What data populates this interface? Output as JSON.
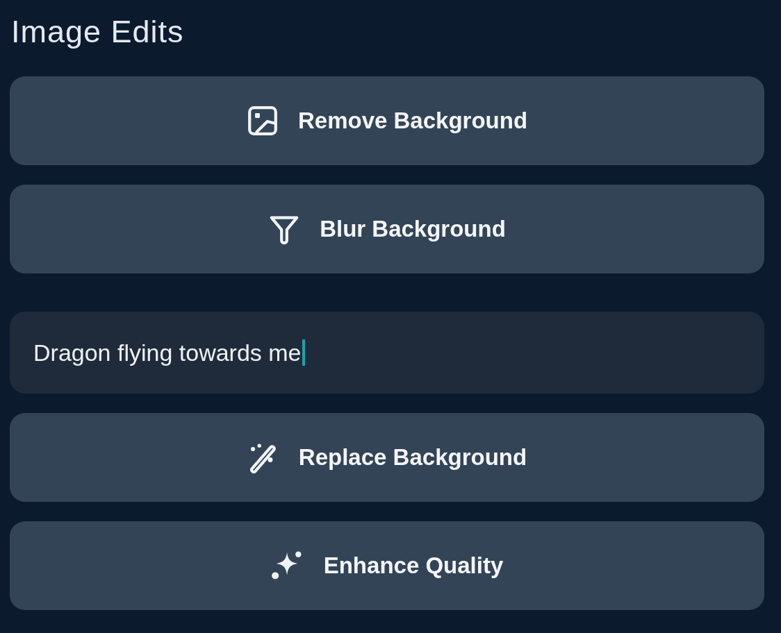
{
  "panel": {
    "title": "Image Edits"
  },
  "actions": [
    {
      "kind": "button",
      "label": "Remove Background"
    },
    {
      "kind": "button",
      "label": "Blur Background"
    },
    {
      "kind": "input",
      "value": "Dragon flying towards me",
      "focused": true
    },
    {
      "kind": "button",
      "label": "Replace Background"
    },
    {
      "kind": "button",
      "label": "Enhance Quality"
    }
  ]
}
